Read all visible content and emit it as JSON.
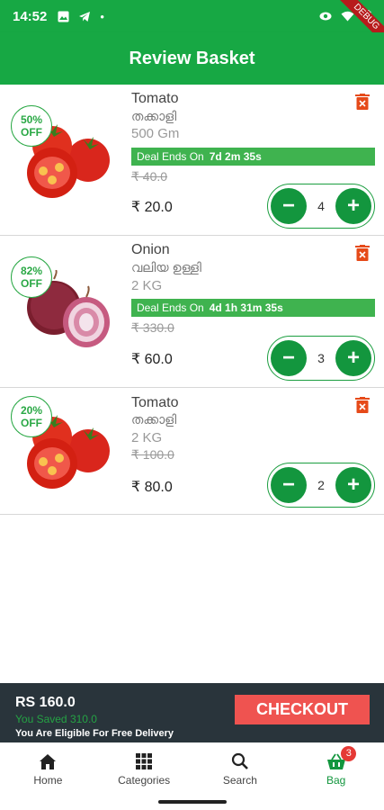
{
  "status_bar": {
    "time": "14:52",
    "left_icons": [
      "image-icon",
      "telegram-icon",
      "dot-icon"
    ],
    "right_icons": [
      "eye-icon",
      "wifi-icon",
      "battery-icon"
    ],
    "debug_label": "DEBUG"
  },
  "app_bar": {
    "title": "Review Basket"
  },
  "items": [
    {
      "name": "Tomato",
      "local_name": "തക്കാളി",
      "quantity": "500 Gm",
      "discount_percent": "50%",
      "discount_label": "OFF",
      "deal_label": "Deal Ends On",
      "deal_time": "7d 2m 35s",
      "mrp": "₹ 40.0",
      "price": "₹ 20.0",
      "count": "4",
      "image": "tomato"
    },
    {
      "name": "Onion",
      "local_name": "വലിയ ഉള്ളി",
      "quantity": "2 KG",
      "discount_percent": "82%",
      "discount_label": "OFF",
      "deal_label": "Deal Ends On",
      "deal_time": "4d 1h 31m 35s",
      "mrp": "₹ 330.0",
      "price": "₹ 60.0",
      "count": "3",
      "image": "onion"
    },
    {
      "name": "Tomato",
      "local_name": "തക്കാളി",
      "quantity": "2 KG",
      "discount_percent": "20%",
      "discount_label": "OFF",
      "mrp": "₹ 100.0",
      "price": "₹ 80.0",
      "count": "2",
      "image": "tomato"
    }
  ],
  "checkout": {
    "total": "RS 160.0",
    "saved": "You Saved 310.0",
    "delivery": "You Are Eligible For Free Delivery",
    "button": "CHECKOUT"
  },
  "bottom_nav": {
    "items": [
      {
        "label": "Home",
        "icon": "home-icon"
      },
      {
        "label": "Categories",
        "icon": "grid-icon"
      },
      {
        "label": "Search",
        "icon": "search-icon"
      },
      {
        "label": "Bag",
        "icon": "basket-icon",
        "badge": "3"
      }
    ]
  },
  "colors": {
    "primary_green": "#17a844",
    "deal_green": "#3fb34f",
    "checkout_red": "#ef5350",
    "delete_red": "#e64a19",
    "checkout_bg": "#29343b"
  }
}
